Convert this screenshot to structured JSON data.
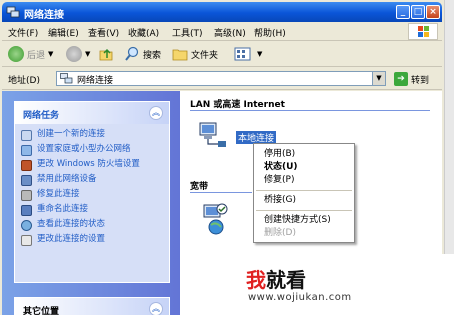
{
  "window": {
    "title": "网络连接",
    "controls": {
      "minimize": "_",
      "maximize": "□",
      "close": "×"
    }
  },
  "menu": [
    "文件(F)",
    "编辑(E)",
    "查看(V)",
    "收藏(A)",
    "工具(T)",
    "高级(N)",
    "帮助(H)"
  ],
  "toolbar": {
    "back_label": "后退",
    "search_label": "搜索",
    "folders_label": "文件夹"
  },
  "address": {
    "label": "地址(D)",
    "value": "网络连接",
    "go_label": "转到"
  },
  "left_pane": {
    "tasks_title": "网络任务",
    "tasks": [
      "创建一个新的连接",
      "设置家庭或小型办公网络",
      "更改 Windows 防火墙设置",
      "禁用此网络设备",
      "修复此连接",
      "重命名此连接",
      "查看此连接的状态",
      "更改此连接的设置"
    ],
    "other_title": "其它位置"
  },
  "right_pane": {
    "group_lan": "LAN 或高速 Internet",
    "group_broadband": "宽带",
    "selected_connection": "本地连接"
  },
  "context_menu": {
    "items": [
      "停用(B)",
      "状态(U)",
      "修复(P)",
      "桥接(G)",
      "创建快捷方式(S)",
      "删除(D)"
    ]
  },
  "watermark": {
    "brand_a": "我",
    "brand_b": "就看",
    "url": "www.wojiukan.com"
  },
  "colors": {
    "titlebar": "#0a55d8",
    "task_link": "#215dc6",
    "selection": "#316ac5",
    "watermark_red": "#e02020"
  }
}
